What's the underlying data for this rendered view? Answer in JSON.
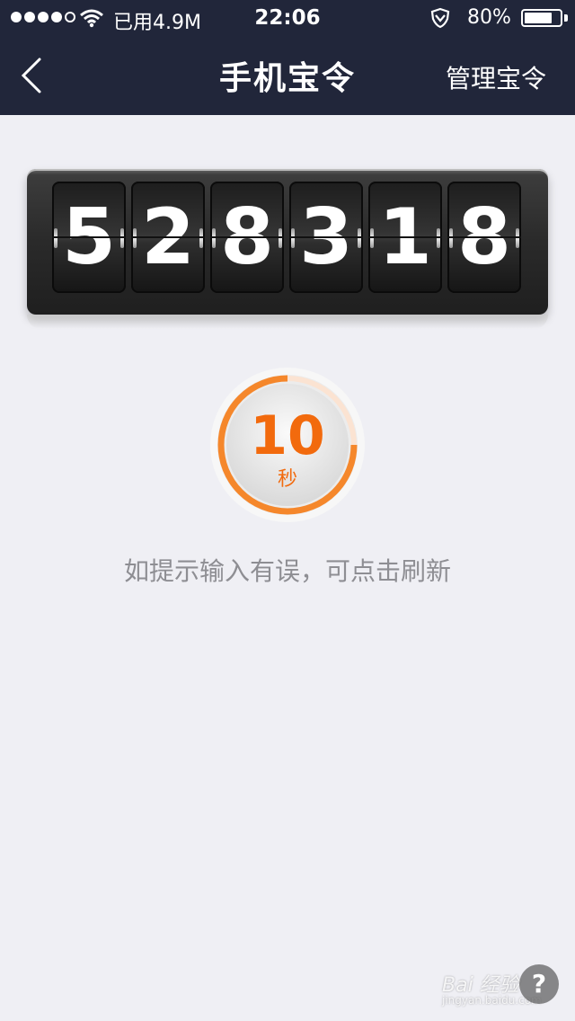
{
  "status_bar": {
    "data_used": "已用4.9M",
    "time": "22:06",
    "battery_percent_label": "80%",
    "battery_level": 0.8
  },
  "nav": {
    "title": "手机宝令",
    "right_action": "管理宝令"
  },
  "token": {
    "digits": [
      "5",
      "2",
      "8",
      "3",
      "1",
      "8"
    ]
  },
  "countdown": {
    "value": "10",
    "unit": "秒",
    "progress_fraction": 0.25,
    "color": "#f26a0d"
  },
  "hint": "如提示输入有误，可点击刷新",
  "watermark": {
    "text": "Bai 经验",
    "sub": "jingyan.baidu.com"
  },
  "help_label": "?",
  "colors": {
    "nav_bg": "#21263a",
    "page_bg": "#efeff4",
    "accent": "#f26a0d"
  }
}
